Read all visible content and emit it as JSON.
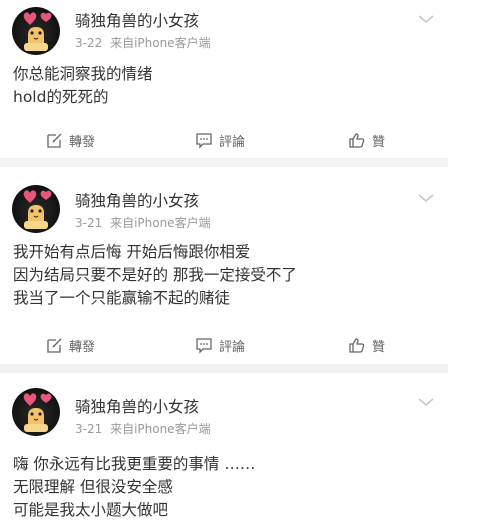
{
  "posts": [
    {
      "username": "骑独角兽的小女孩",
      "date": "3-22",
      "source": "来自iPhone客户端",
      "lines": [
        "你总能洞察我的情绪",
        "hold的死死的"
      ]
    },
    {
      "username": "骑独角兽的小女孩",
      "date": "3-21",
      "source": "来自iPhone客户端",
      "lines": [
        "我开始有点后悔 开始后悔跟你相爱",
        "因为结局只要不是好的 那我一定接受不了",
        "我当了一个只能赢输不起的赌徒"
      ]
    },
    {
      "username": "骑独角兽的小女孩",
      "date": "3-21",
      "source": "来自iPhone客户端",
      "lines": [
        "嗨 你永远有比我更重要的事情 ……",
        "无限理解 但很没安全感",
        "可能是我太小题大做吧"
      ]
    }
  ],
  "actions": {
    "repost": "轉發",
    "comment": "評論",
    "like": "贊"
  },
  "icons": {
    "repost": "share-edit-icon",
    "comment": "comment-bubble-icon",
    "like": "thumbs-up-icon",
    "menu": "chevron-down-icon"
  },
  "colors": {
    "text": "#333333",
    "meta": "#999999",
    "separator": "#f2f2f2",
    "action": "#666666"
  }
}
